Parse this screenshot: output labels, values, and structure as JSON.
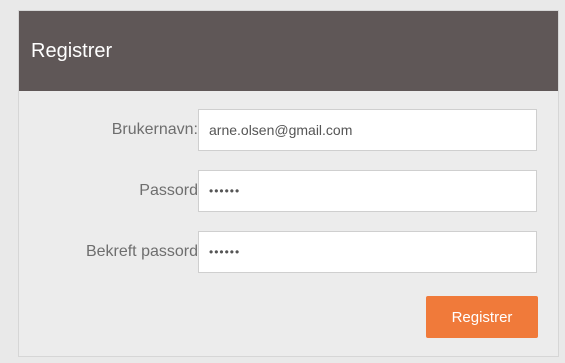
{
  "panel": {
    "title": "Registrer"
  },
  "form": {
    "username": {
      "label": "Brukernavn:",
      "value": "arne.olsen@gmail.com"
    },
    "password": {
      "label": "Passord",
      "value": "••••••"
    },
    "confirm_password": {
      "label": "Bekreft passord",
      "value": "••••••"
    },
    "submit_label": "Registrer"
  },
  "colors": {
    "header_bg": "#5f5757",
    "button_bg": "#f07a3a",
    "panel_bg": "#ececec"
  }
}
